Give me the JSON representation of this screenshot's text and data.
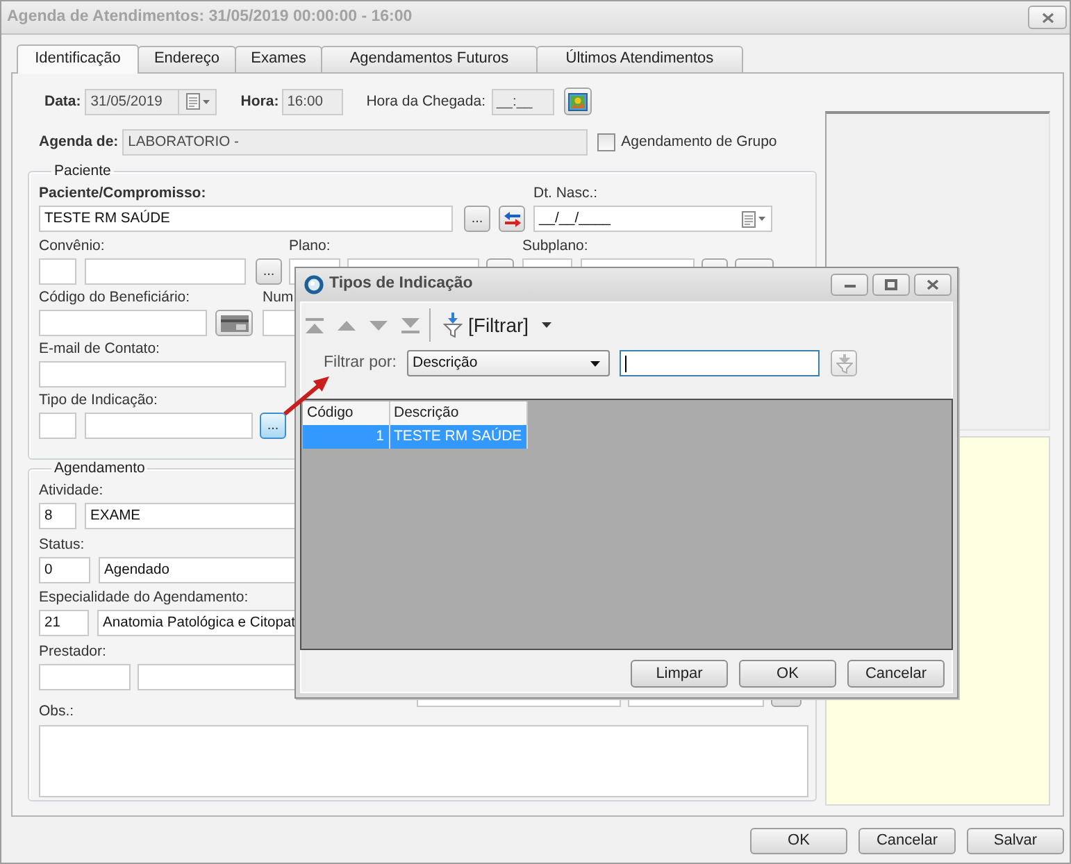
{
  "window": {
    "title": "Agenda de Atendimentos: 31/05/2019 00:00:00 - 16:00",
    "active": false
  },
  "tabs": [
    {
      "label": "Identificação",
      "selected": true
    },
    {
      "label": "Endereço",
      "selected": false
    },
    {
      "label": "Exames",
      "selected": false
    },
    {
      "label": "Agendamentos Futuros",
      "selected": false
    },
    {
      "label": "Últimos Atendimentos",
      "selected": false
    }
  ],
  "schedule": {
    "date": {
      "label": "Data:",
      "value": "31/05/2019",
      "disabled": true
    },
    "time": {
      "label": "Hora:",
      "value": "16:00",
      "disabled": true
    },
    "arrival": {
      "label": "Hora da Chegada:",
      "value": "__:__",
      "disabled": true
    },
    "agenda": {
      "label": "Agenda de:",
      "value": "LABORATORIO -",
      "disabled": true
    },
    "group_checkbox": {
      "label": "Agendamento de Grupo",
      "checked": false
    }
  },
  "patient_group": {
    "legend": "Paciente",
    "patient": {
      "label": "Paciente/Compromisso:",
      "value": "TESTE RM SAÚDE",
      "button": {
        "label": "...",
        "highlighted": false
      }
    },
    "birth_date": {
      "label": "Dt. Nasc.:",
      "value": "__/__/____"
    },
    "insurance": {
      "label": "Convênio:",
      "button": {
        "label": "...",
        "highlighted": false
      }
    },
    "plan": {
      "label": "Plano:"
    },
    "subplan": {
      "label": "Subplano:"
    },
    "beneficiary_code": {
      "label": "Código do Beneficiário:"
    },
    "number": {
      "label": "Num"
    },
    "email": {
      "label": "E-mail de Contato:"
    },
    "indication": {
      "label": "Tipo de Indicação:",
      "button": {
        "label": "...",
        "highlighted": true
      }
    }
  },
  "appointment_group": {
    "legend": "Agendamento",
    "activity": {
      "label": "Atividade:",
      "code": "8",
      "name": "EXAME"
    },
    "status": {
      "label": "Status:",
      "code": "0",
      "name": "Agendado"
    },
    "specialty": {
      "label": "Especialidade do Agendamento:",
      "code": "21",
      "name": "Anatomia Patológica e Citopat"
    },
    "provider": {
      "label": "Prestador:"
    },
    "notes": {
      "label": "Obs.:"
    }
  },
  "buttons": [
    "OK",
    "Cancelar",
    "Salvar"
  ],
  "dialog": {
    "title": "Tipos de Indicação",
    "record_nav": [
      {
        "kind": "first",
        "disabled": true
      },
      {
        "kind": "previous",
        "disabled": true
      },
      {
        "kind": "next",
        "disabled": true
      },
      {
        "kind": "last",
        "disabled": true
      }
    ],
    "filter_menu": "[Filtrar]",
    "filter_label": "Filtrar por:",
    "filter_by": "Descrição",
    "search_field": {
      "focused": true
    },
    "apply_filter": {
      "disabled": true
    },
    "table": {
      "columns": [
        "Código",
        "Descrição"
      ],
      "rows": [
        {
          "cells": [
            "1",
            "TESTE RM SAÚDE"
          ],
          "selected": true
        }
      ]
    },
    "buttons": [
      "Limpar",
      "OK",
      "Cancelar"
    ]
  }
}
